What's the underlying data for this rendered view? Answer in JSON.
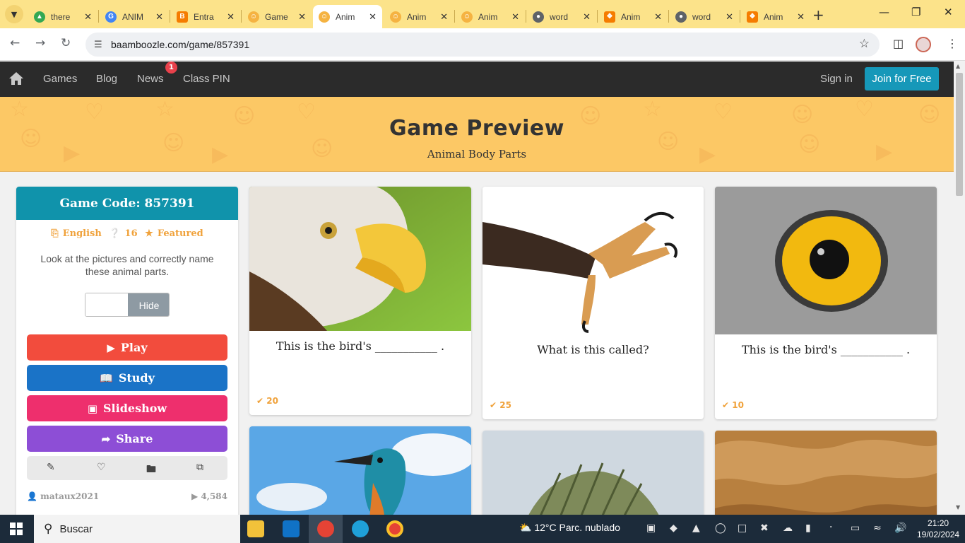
{
  "browser": {
    "tabs": [
      {
        "label": "there",
        "favicon_color": "#34a853",
        "active": false
      },
      {
        "label": "ANIM",
        "favicon_color": "#4285f4",
        "active": false
      },
      {
        "label": "Entra",
        "favicon_color": "#f57c00",
        "active": false
      },
      {
        "label": "Game",
        "favicon_color": "#f5b342",
        "active": false
      },
      {
        "label": "Anim",
        "favicon_color": "#f5b342",
        "active": true
      },
      {
        "label": "Anim",
        "favicon_color": "#f5b342",
        "active": false
      },
      {
        "label": "Anim",
        "favicon_color": "#f5b342",
        "active": false
      },
      {
        "label": "word",
        "favicon_color": "#5f6368",
        "active": false
      },
      {
        "label": "Anim",
        "favicon_color": "#f57c00",
        "active": false
      },
      {
        "label": "word",
        "favicon_color": "#5f6368",
        "active": false
      },
      {
        "label": "Anim",
        "favicon_color": "#f57c00",
        "active": false
      }
    ],
    "url": "baamboozle.com/game/857391"
  },
  "site_nav": {
    "links": [
      "Games",
      "Blog",
      "News",
      "Class PIN"
    ],
    "news_badge": "1",
    "sign_in": "Sign in",
    "join": "Join for Free"
  },
  "hero": {
    "title": "Game Preview",
    "subtitle": "Animal Body Parts"
  },
  "sidebar": {
    "game_code": "Game Code: 857391",
    "language": "English",
    "question_count": "16",
    "featured": "Featured",
    "description": "Look at the pictures and correctly name these animal parts.",
    "hide_label": "Hide",
    "buttons": {
      "play": "Play",
      "study": "Study",
      "slideshow": "Slideshow",
      "share": "Share"
    },
    "author": "mataux2021",
    "plays": "4,584"
  },
  "cards": [
    {
      "question": "This is the bird's ___________ .",
      "points": "20"
    },
    {
      "question": "What is this called?",
      "points": "25"
    },
    {
      "question": "This is the bird's ___________ .",
      "points": "10"
    }
  ],
  "taskbar": {
    "search_label": "Buscar",
    "weather": "12°C  Parc. nublado",
    "time": "21:20",
    "date": "19/02/2024"
  },
  "colors": {
    "play": "#f24c3d",
    "study": "#1a73c7",
    "slideshow": "#ee2f6d",
    "share": "#8d4ed6",
    "accent_teal": "#1093ab",
    "hero_yellow": "#fcc865"
  }
}
